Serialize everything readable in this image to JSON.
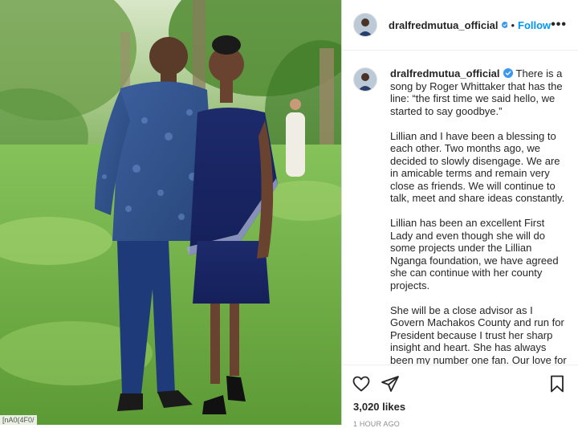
{
  "post": {
    "author": {
      "username": "dralfredmutua_official",
      "verified": true,
      "avatar_icon": "profile-avatar"
    },
    "header": {
      "separator": "•",
      "follow_label": "Follow",
      "more_icon": "ellipsis-icon",
      "more_label": "•••"
    },
    "caption": {
      "paragraphs": [
        "There is a song by Roger Whittaker that has the line: “the first time we said hello, we started to say goodbye.”",
        "Lillian and I have been a blessing to each other. Two months ago, we decided to slowly disengage. We are in amicable terms and remain very close as friends. We will continue to talk, meet and share ideas constantly.",
        "Lillian has been an excellent First Lady and even though she will do some projects under the Lillian Nganga foundation, we have agreed she can continue with her county projects.",
        "She will be a close advisor as I Govern Machakos County and run for President because I trust her sharp insight and heart. She has always been my number one fan. Our love for each other is enormous but I think at"
      ]
    },
    "media": {
      "caption_fragment": "[nA0(4F0/"
    },
    "actions": {
      "like_icon": "heart-icon",
      "share_icon": "paper-plane-icon",
      "save_icon": "bookmark-icon"
    },
    "likes": "3,020 likes",
    "timestamp": "1 HOUR AGO",
    "colors": {
      "accent": "#0095f6",
      "verified": "#3897f0",
      "text": "#262626",
      "muted": "#8e8e8e"
    }
  }
}
